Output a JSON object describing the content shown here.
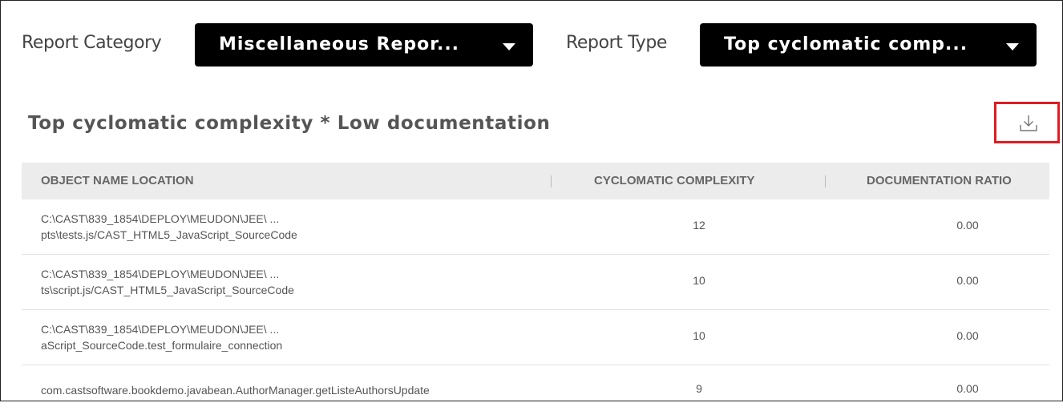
{
  "filters": {
    "category_label": "Report Category",
    "category_value": "Miscellaneous Repor...",
    "type_label": "Report Type",
    "type_value": "Top cyclomatic comp..."
  },
  "section": {
    "title": "Top cyclomatic complexity * Low documentation",
    "download_icon": "download-icon",
    "highlight_color": "#e01b22"
  },
  "table": {
    "columns": [
      "OBJECT NAME LOCATION",
      "CYCLOMATIC COMPLEXITY",
      "DOCUMENTATION RATIO"
    ],
    "rows": [
      {
        "name_line1": "C:\\CAST\\839_1854\\DEPLOY\\MEUDON\\JEE\\ ...",
        "name_line2": "pts\\tests.js/CAST_HTML5_JavaScript_SourceCode",
        "complexity": "12",
        "doc_ratio": "0.00"
      },
      {
        "name_line1": "C:\\CAST\\839_1854\\DEPLOY\\MEUDON\\JEE\\ ...",
        "name_line2": "ts\\script.js/CAST_HTML5_JavaScript_SourceCode",
        "complexity": "10",
        "doc_ratio": "0.00"
      },
      {
        "name_line1": "C:\\CAST\\839_1854\\DEPLOY\\MEUDON\\JEE\\ ...",
        "name_line2": "aScript_SourceCode.test_formulaire_connection",
        "complexity": "10",
        "doc_ratio": "0.00"
      },
      {
        "name_line1": "com.castsoftware.bookdemo.javabean.AuthorManager.getListeAuthorsUpdate",
        "complexity": "9",
        "doc_ratio": "0.00"
      }
    ]
  }
}
